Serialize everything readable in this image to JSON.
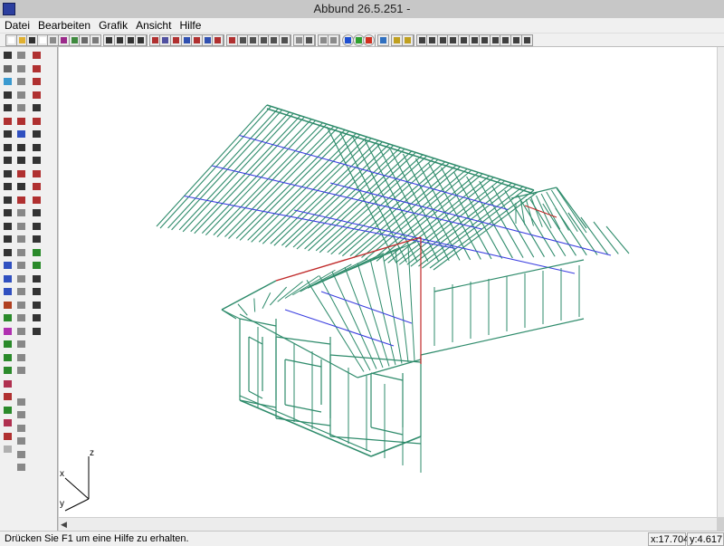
{
  "window": {
    "title": "Abbund 26.5.251 -"
  },
  "menu": {
    "items": [
      "Datei",
      "Bearbeiten",
      "Grafik",
      "Ansicht",
      "Hilfe"
    ]
  },
  "toolbar": {
    "buttons": [
      {
        "icon": "new-document-icon",
        "color": "#ffffff"
      },
      {
        "icon": "open-folder-icon",
        "color": "#e0b030"
      },
      {
        "icon": "save-icon",
        "color": "#303030"
      },
      {
        "icon": "page-icon",
        "color": "#ffffff"
      },
      {
        "icon": "print-preview-icon",
        "color": "#8a8a8a"
      },
      {
        "icon": "layers-icon",
        "color": "#9b2a8a"
      },
      {
        "icon": "export-icon",
        "color": "#3f8a3f"
      },
      {
        "icon": "print-icon",
        "color": "#6a6a6a"
      },
      {
        "icon": "copy-icon",
        "color": "#7a7a7a"
      },
      {
        "icon": "view-front-icon",
        "color": "#333333"
      },
      {
        "icon": "view-side-icon",
        "color": "#333333"
      },
      {
        "icon": "view-top-icon",
        "color": "#333333"
      },
      {
        "icon": "view-split-icon",
        "color": "#333333"
      },
      {
        "icon": "view-3d-icon",
        "color": "#b03030"
      },
      {
        "icon": "snap-grid-icon",
        "color": "#5050a0"
      },
      {
        "icon": "snap-point-icon",
        "color": "#b03030"
      },
      {
        "icon": "snap-line-icon",
        "color": "#3050b0"
      },
      {
        "icon": "snap-end-icon",
        "color": "#b03030"
      },
      {
        "icon": "snap-center-icon",
        "color": "#3050b0"
      },
      {
        "icon": "hatch-icon",
        "color": "#b03030"
      },
      {
        "icon": "house-icon",
        "color": "#b03030"
      },
      {
        "icon": "scissors-icon",
        "color": "#505050"
      },
      {
        "icon": "zoom-in-icon",
        "color": "#505050"
      },
      {
        "icon": "zoom-out-icon",
        "color": "#505050"
      },
      {
        "icon": "zoom-window-icon",
        "color": "#505050"
      },
      {
        "icon": "zoom-all-icon",
        "color": "#505050"
      },
      {
        "icon": "undo-icon",
        "color": "#8a8a8a"
      },
      {
        "icon": "edit-icon",
        "color": "#505050"
      },
      {
        "icon": "check-icon",
        "color": "#8a8a8a"
      },
      {
        "icon": "cancel-icon",
        "color": "#8a8a8a"
      },
      {
        "icon": "info-blue-icon",
        "color": "#2050d0"
      },
      {
        "icon": "info-green-icon",
        "color": "#30a030"
      },
      {
        "icon": "info-red-icon",
        "color": "#d03020"
      },
      {
        "icon": "diamond-icon",
        "color": "#3070c0"
      },
      {
        "icon": "help-icon",
        "color": "#c0a020"
      },
      {
        "icon": "context-help-icon",
        "color": "#c0a020"
      },
      {
        "icon": "window-1-icon",
        "color": "#404040"
      },
      {
        "icon": "window-2-icon",
        "color": "#404040"
      },
      {
        "icon": "window-3-icon",
        "color": "#404040"
      },
      {
        "icon": "window-4-icon",
        "color": "#404040"
      },
      {
        "icon": "window-5-icon",
        "color": "#404040"
      },
      {
        "icon": "window-6-icon",
        "color": "#404040"
      },
      {
        "icon": "window-7-icon",
        "color": "#404040"
      },
      {
        "icon": "window-8-icon",
        "color": "#404040"
      },
      {
        "icon": "window-9-icon",
        "color": "#404040"
      },
      {
        "icon": "window-10-icon",
        "color": "#404040"
      },
      {
        "icon": "window-11-icon",
        "color": "#404040"
      }
    ]
  },
  "left_toolbar": {
    "col1": [
      {
        "icon": "wall-tool-icon",
        "color": "#333333"
      },
      {
        "icon": "framing-icon",
        "color": "#666666"
      },
      {
        "icon": "3d-object-icon",
        "color": "#3a9ad0"
      },
      {
        "icon": "delete-x-icon",
        "color": "#333333"
      },
      {
        "icon": "line-tool-icon",
        "color": "#333333"
      },
      {
        "icon": "measure-icon",
        "color": "#b03030"
      },
      {
        "icon": "dimension-icon",
        "color": "#333333"
      },
      {
        "icon": "triangle-icon",
        "color": "#333333"
      },
      {
        "icon": "text-icon",
        "color": "#333333"
      },
      {
        "icon": "rotate-icon",
        "color": "#333333"
      },
      {
        "icon": "rectangle-icon",
        "color": "#333333"
      },
      {
        "icon": "circle-icon",
        "color": "#333333"
      },
      {
        "icon": "arc-icon",
        "color": "#333333"
      },
      {
        "icon": "ellipse-icon",
        "color": "#333333"
      },
      {
        "icon": "curve-icon",
        "color": "#333333"
      },
      {
        "icon": "angle-icon",
        "color": "#333333"
      },
      {
        "icon": "roof-blue-icon",
        "color": "#3050c0"
      },
      {
        "icon": "roof-outline-icon",
        "color": "#3050c0"
      },
      {
        "icon": "beam-icon",
        "color": "#3050c0"
      },
      {
        "icon": "cut-icon",
        "color": "#b04020"
      },
      {
        "icon": "paint-icon",
        "color": "#2a8a2a"
      },
      {
        "icon": "target-icon",
        "color": "#b030b0"
      },
      {
        "icon": "slash-icon",
        "color": "#2a8a2a"
      },
      {
        "icon": "slash2-icon",
        "color": "#2a8a2a"
      },
      {
        "icon": "slash3-icon",
        "color": "#2a8a2a"
      },
      {
        "icon": "arch-icon",
        "color": "#b03050"
      },
      {
        "icon": "joint-icon",
        "color": "#b03030"
      },
      {
        "icon": "joint2-icon",
        "color": "#2a8a2a"
      },
      {
        "icon": "joint3-icon",
        "color": "#b03050"
      },
      {
        "icon": "cycle-icon",
        "color": "#b03030"
      },
      {
        "icon": "pencil-icon",
        "color": "#b0b0b0"
      }
    ],
    "col2": [
      {
        "icon": "grid-icon",
        "color": "#888888"
      },
      {
        "icon": "plane-icon",
        "color": "#888888"
      },
      {
        "icon": "box-icon",
        "color": "#888888"
      },
      {
        "icon": "cross-icon",
        "color": "#888888"
      },
      {
        "icon": "stop-icon",
        "color": "#888888"
      },
      {
        "icon": "red-box-icon",
        "color": "#b03030"
      },
      {
        "icon": "blue-box-icon",
        "color": "#3050c0"
      },
      {
        "icon": "parallelogram-icon",
        "color": "#333333"
      },
      {
        "icon": "frame-icon",
        "color": "#333333"
      },
      {
        "icon": "pattern-icon",
        "color": "#b03030"
      },
      {
        "icon": "square-icon",
        "color": "#333333"
      },
      {
        "icon": "layers-icon",
        "color": "#b03030"
      },
      {
        "icon": "image-icon",
        "color": "#888888"
      },
      {
        "icon": "ruler-icon",
        "color": "#888888"
      },
      {
        "icon": "steps-icon",
        "color": "#888888"
      },
      {
        "icon": "layers2-icon",
        "color": "#888888"
      },
      {
        "icon": "layers3-icon",
        "color": "#888888"
      },
      {
        "icon": "layers4-icon",
        "color": "#888888"
      },
      {
        "icon": "layers5-icon",
        "color": "#888888"
      },
      {
        "icon": "cube-icon",
        "color": "#888888"
      },
      {
        "icon": "cube2-icon",
        "color": "#888888"
      },
      {
        "icon": "drill-icon",
        "color": "#888888"
      },
      {
        "icon": "mesh-icon",
        "color": "#888888"
      },
      {
        "icon": "mesh2-icon",
        "color": "#888888"
      },
      {
        "icon": "mesh3-icon",
        "color": "#888888"
      },
      {
        "icon": "bracket-icon",
        "color": "#888888"
      },
      {
        "icon": "bracket2-icon",
        "color": "#888888"
      },
      {
        "icon": "hat-icon",
        "color": "#888888"
      },
      {
        "icon": "hat2-icon",
        "color": "#888888"
      },
      {
        "icon": "hat3-icon",
        "color": "#888888"
      },
      {
        "icon": "hat4-icon",
        "color": "#888888"
      }
    ],
    "col3": [
      {
        "icon": "point-icon",
        "color": "#b03030"
      },
      {
        "icon": "node-icon",
        "color": "#b03030"
      },
      {
        "icon": "tree-icon",
        "color": "#b03030"
      },
      {
        "icon": "branch-icon",
        "color": "#b03030"
      },
      {
        "icon": "star-icon",
        "color": "#333333"
      },
      {
        "icon": "flag-icon",
        "color": "#b03030"
      },
      {
        "icon": "square-outline-icon",
        "color": "#333333"
      },
      {
        "icon": "grid-fill-icon",
        "color": "#333333"
      },
      {
        "icon": "grid-small-icon",
        "color": "#333333"
      },
      {
        "icon": "trim-icon",
        "color": "#b03030"
      },
      {
        "icon": "trim2-icon",
        "color": "#b03030"
      },
      {
        "icon": "split-icon",
        "color": "#b03030"
      },
      {
        "icon": "checkmark-icon",
        "color": "#333333"
      },
      {
        "icon": "chart-icon",
        "color": "#333333"
      },
      {
        "icon": "chart2-icon",
        "color": "#333333"
      },
      {
        "icon": "photo-icon",
        "color": "#2a8a2a"
      },
      {
        "icon": "photo2-icon",
        "color": "#2a8a2a"
      },
      {
        "icon": "align-icon",
        "color": "#333333"
      },
      {
        "icon": "align2-icon",
        "color": "#333333"
      },
      {
        "icon": "align3-icon",
        "color": "#333333"
      },
      {
        "icon": "align4-icon",
        "color": "#333333"
      },
      {
        "icon": "align5-icon",
        "color": "#333333"
      }
    ]
  },
  "viewport": {
    "axis_labels": {
      "z": "z",
      "x": "x",
      "y": "y"
    },
    "colors": {
      "frame": "#2e8b6b",
      "purlin": "#3b3fe0",
      "ridge": "#c02a2a"
    }
  },
  "statusbar": {
    "hint": "Drücken Sie F1 um eine Hilfe zu erhalten.",
    "x": "x:17.704",
    "y": "y:4.617"
  }
}
